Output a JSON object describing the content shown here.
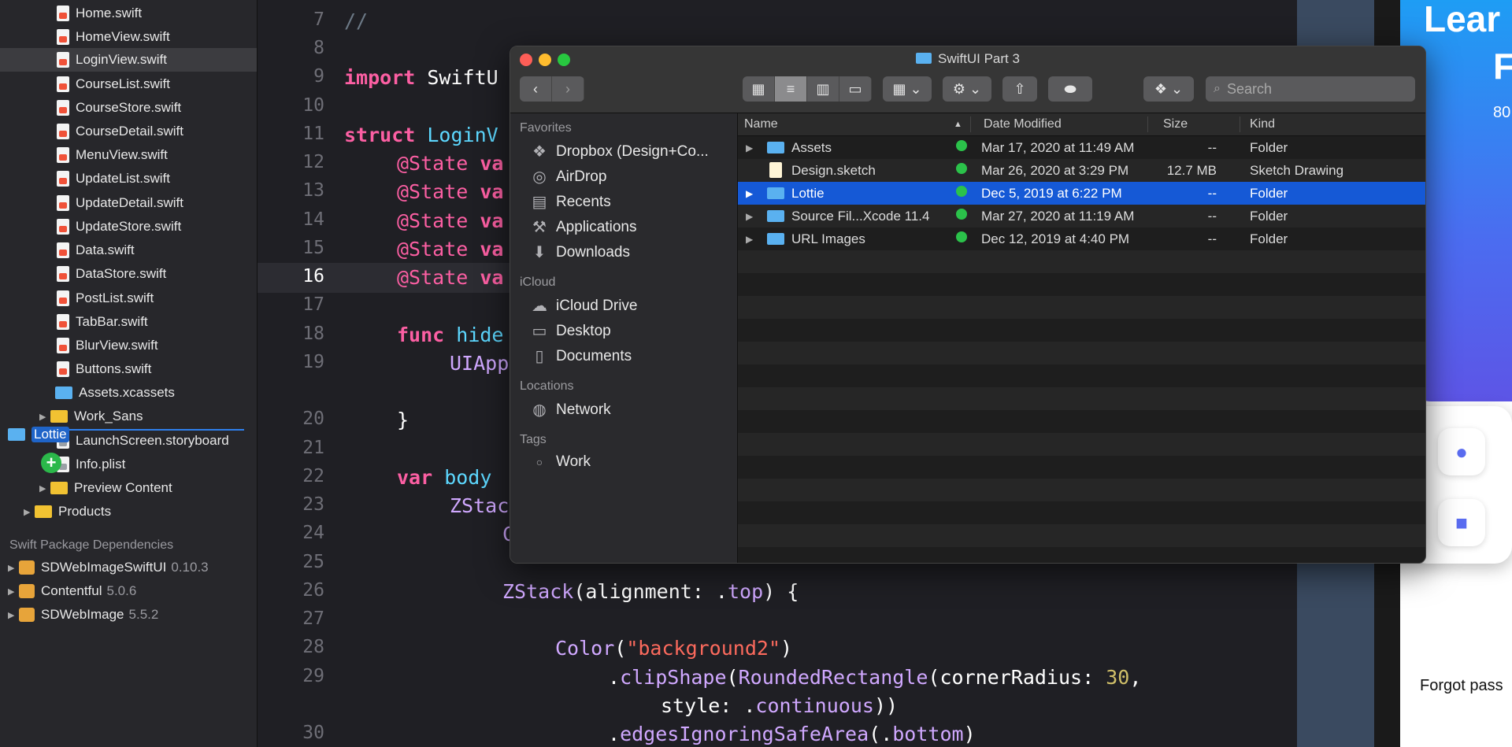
{
  "navigator": {
    "files": [
      {
        "name": "Home.swift"
      },
      {
        "name": "HomeView.swift"
      },
      {
        "name": "LoginView.swift"
      },
      {
        "name": "CourseList.swift"
      },
      {
        "name": "CourseStore.swift"
      },
      {
        "name": "CourseDetail.swift"
      },
      {
        "name": "MenuView.swift"
      },
      {
        "name": "UpdateList.swift"
      },
      {
        "name": "UpdateDetail.swift"
      },
      {
        "name": "UpdateStore.swift"
      },
      {
        "name": "Data.swift"
      },
      {
        "name": "DataStore.swift"
      },
      {
        "name": "PostList.swift"
      },
      {
        "name": "TabBar.swift"
      },
      {
        "name": "BlurView.swift"
      },
      {
        "name": "Buttons.swift"
      }
    ],
    "assets": "Assets.xcassets",
    "work_sans": "Work_Sans",
    "launch": "LaunchScreen.storyboard",
    "info": "Info.plist",
    "preview": "Preview Content",
    "products": "Products",
    "dragging": "Lottie",
    "packages_title": "Swift Package Dependencies",
    "packages": [
      {
        "name": "SDWebImageSwiftUI",
        "version": "0.10.3"
      },
      {
        "name": "Contentful",
        "version": "5.0.6"
      },
      {
        "name": "SDWebImage",
        "version": "5.5.2"
      }
    ]
  },
  "editor": {
    "line_numbers": [
      "7",
      "8",
      "9",
      "10",
      "11",
      "12",
      "13",
      "14",
      "15",
      "16",
      "17",
      "18",
      "19",
      "20",
      "21",
      "22",
      "23",
      "24",
      "25",
      "26",
      "27",
      "28",
      "29",
      "30"
    ],
    "code": {
      "l7": "//",
      "l9_kw": "import",
      "l9_rest": " SwiftU",
      "l11_kw": "struct",
      "l11_rest": " LoginV",
      "state_kw": "@State",
      "state_rest": " va",
      "l18_kw": "func",
      "l18_rest": " hide",
      "l19": "UIApp",
      "l20": "}",
      "l22_kw": "var",
      "l22_rest": " body",
      "l23": "ZStac",
      "l24": "C",
      "l26_a": "ZStack",
      "l26_b": "(alignment: .",
      "l26_c": "top",
      "l26_d": ") {",
      "l28_a": "Color",
      "l28_b": "(",
      "l28_c": "\"background2\"",
      "l28_d": ")",
      "l29_a": ".",
      "l29_b": "clipShape",
      "l29_c": "(",
      "l29_d": "RoundedRectangle",
      "l29_e": "(cornerRadius: ",
      "l29_f": "30",
      "l29_g": ",",
      "l29b_a": "style: .",
      "l29b_b": "continuous",
      "l29b_c": "))",
      "l30_a": ".",
      "l30_b": "edgesIgnoringSafeArea",
      "l30_c": "(.",
      "l30_d": "bottom",
      "l30_e": ")"
    }
  },
  "preview": {
    "title_line1": "Lear",
    "title_line2": "F",
    "sub": "80",
    "forgot": "Forgot pass"
  },
  "finder": {
    "title": "SwiftUI Part 3",
    "search_placeholder": "Search",
    "sidebar": {
      "favorites": "Favorites",
      "fav_items": [
        "Dropbox (Design+Co...",
        "AirDrop",
        "Recents",
        "Applications",
        "Downloads"
      ],
      "icloud": "iCloud",
      "icloud_items": [
        "iCloud Drive",
        "Desktop",
        "Documents"
      ],
      "locations": "Locations",
      "location_items": [
        "Network"
      ],
      "tags": "Tags",
      "tag_items": [
        "Work"
      ]
    },
    "columns": {
      "name": "Name",
      "date": "Date Modified",
      "size": "Size",
      "kind": "Kind"
    },
    "rows": [
      {
        "name": "Assets",
        "date": "Mar 17, 2020 at 11:49 AM",
        "size": "--",
        "kind": "Folder"
      },
      {
        "name": "Design.sketch",
        "date": "Mar 26, 2020 at 3:29 PM",
        "size": "12.7 MB",
        "kind": "Sketch Drawing"
      },
      {
        "name": "Lottie",
        "date": "Dec 5, 2019 at 6:22 PM",
        "size": "--",
        "kind": "Folder"
      },
      {
        "name": "Source Fil...Xcode 11.4",
        "date": "Mar 27, 2020 at 11:19 AM",
        "size": "--",
        "kind": "Folder"
      },
      {
        "name": "URL Images",
        "date": "Dec 12, 2019 at 4:40 PM",
        "size": "--",
        "kind": "Folder"
      }
    ],
    "colors": {
      "selection": "#1559d6",
      "synced": "#2bc24a",
      "folder": "#5ab1f0"
    }
  }
}
